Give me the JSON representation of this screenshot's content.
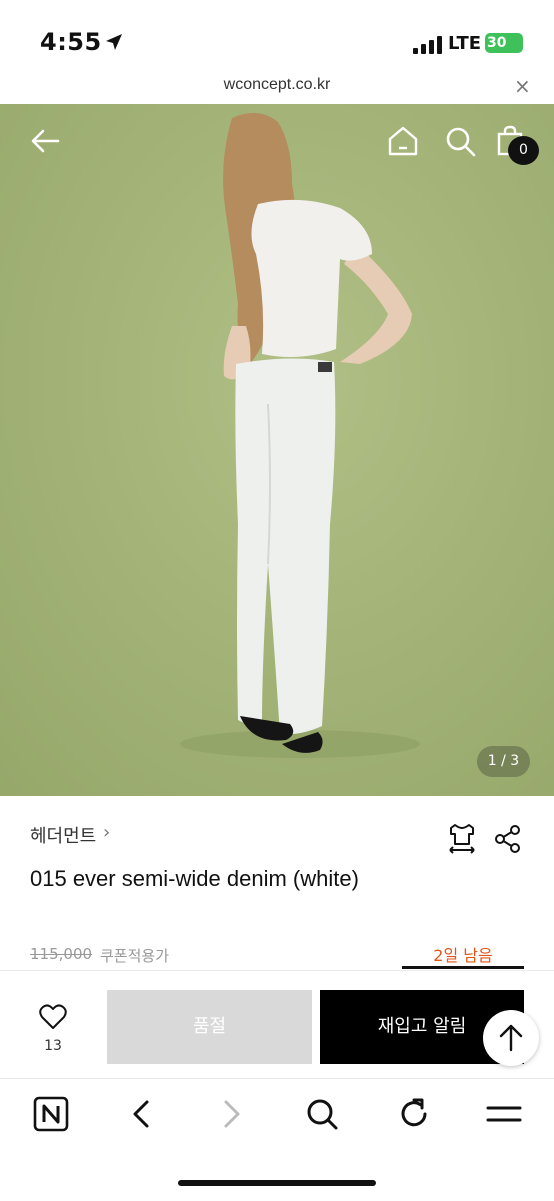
{
  "status_bar": {
    "time": "4:55",
    "network": "LTE",
    "battery": "30"
  },
  "url_bar": {
    "url": "wconcept.co.kr",
    "close": "×"
  },
  "hero": {
    "bag_count": "0",
    "pager": "1 / 3"
  },
  "product": {
    "brand": "헤더먼트",
    "brand_chevron": "›",
    "title": "015 ever semi-wide denim (white)",
    "original_price": "115,000",
    "coupon_label": "쿠폰적용가",
    "days_left": "2일 남음"
  },
  "actions": {
    "wish_count": "13",
    "soldout_label": "품절",
    "restock_label": "재입고 알림"
  },
  "colors": {
    "backdrop": "#a3b377",
    "accent_orange": "#e0571c",
    "battery_green": "#3ec15b"
  },
  "icons": {
    "status": [
      "location-arrow-icon",
      "signal-icon",
      "battery-icon"
    ],
    "hero": [
      "back-arrow-icon",
      "home-icon",
      "search-icon",
      "shopping-bag-icon"
    ],
    "product": [
      "size-chart-icon",
      "share-icon"
    ],
    "actions": [
      "heart-icon",
      "arrow-up-icon"
    ],
    "toolbar": [
      "naver-n-icon",
      "back-chevron-icon",
      "forward-chevron-icon",
      "search-icon",
      "reload-icon",
      "menu-icon"
    ]
  }
}
